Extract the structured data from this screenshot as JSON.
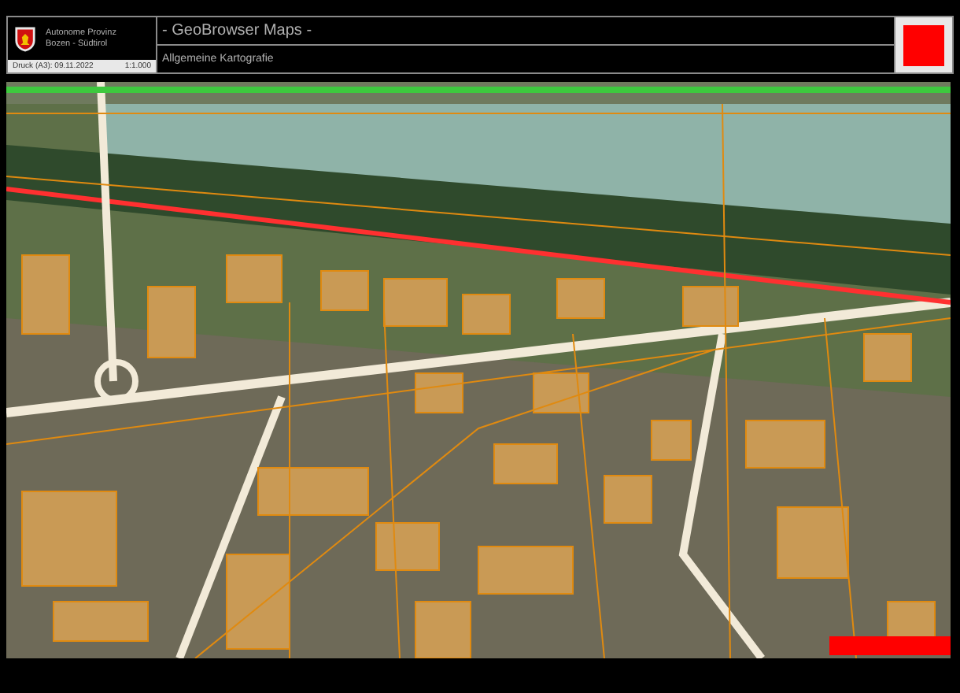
{
  "header": {
    "authority_line_1": "Autonome Provinz",
    "authority_line_2": "Bozen - Südtirol",
    "print_info": "Druck (A3): 09.11.2022",
    "scale": "1:1.000",
    "title": "- GeoBrowser Maps -",
    "subtitle": "Allgemeine Kartografie"
  }
}
